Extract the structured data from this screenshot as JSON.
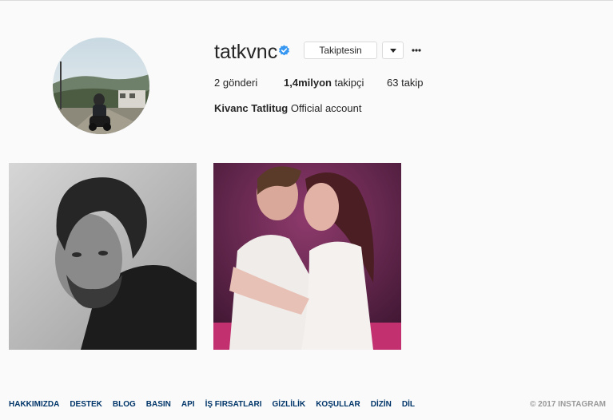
{
  "profile": {
    "username": "tatkvnc",
    "follow_button": "Takiptesin",
    "stats": {
      "posts_count": "2",
      "posts_label": " gönderi",
      "followers_count": "1,4milyon",
      "followers_label": " takipçi",
      "following_count": "63",
      "following_label": " takip"
    },
    "full_name": "Kivanc Tatlitug",
    "bio": "Official account",
    "verified_color": "#3897f0",
    "icons": [
      "verified-badge-icon",
      "chevron-down-icon",
      "more-options-icon"
    ]
  },
  "posts": [
    {
      "type": "photo",
      "tone": "black-and-white portrait"
    },
    {
      "type": "photo",
      "tone": "pink-lit couple embracing"
    }
  ],
  "footer": {
    "links": [
      "HAKKIMIZDA",
      "DESTEK",
      "BLOG",
      "BASIN",
      "API",
      "İŞ FIRSATLARI",
      "GİZLİLİK",
      "KOŞULLAR",
      "DİZİN",
      "DİL"
    ],
    "copyright": "© 2017 INSTAGRAM"
  }
}
